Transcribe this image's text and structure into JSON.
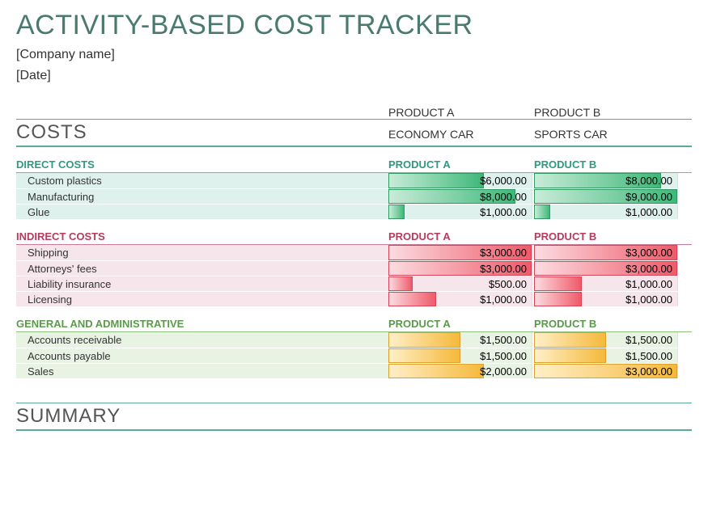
{
  "title": "ACTIVITY-BASED COST TRACKER",
  "company": "[Company name]",
  "date": "[Date]",
  "product_labels": {
    "a": "PRODUCT A",
    "b": "PRODUCT B"
  },
  "costs_heading": "COSTS",
  "product_names": {
    "a": "ECONOMY CAR",
    "b": "SPORTS CAR"
  },
  "summary_heading": "SUMMARY",
  "sections": {
    "direct": {
      "title": "DIRECT COSTS",
      "col_a": "PRODUCT A",
      "col_b": "PRODUCT B",
      "max": 9000,
      "rows": [
        {
          "label": "Custom plastics",
          "a_val": 6000,
          "a_text": "$6,000.00",
          "b_val": 8000,
          "b_text": "$8,000.00"
        },
        {
          "label": "Manufacturing",
          "a_val": 8000,
          "a_text": "$8,000.00",
          "b_val": 9000,
          "b_text": "$9,000.00"
        },
        {
          "label": "Glue",
          "a_val": 1000,
          "a_text": "$1,000.00",
          "b_val": 1000,
          "b_text": "$1,000.00"
        }
      ]
    },
    "indirect": {
      "title": "INDIRECT COSTS",
      "col_a": "PRODUCT A",
      "col_b": "PRODUCT B",
      "max": 3000,
      "rows": [
        {
          "label": "Shipping",
          "a_val": 3000,
          "a_text": "$3,000.00",
          "b_val": 3000,
          "b_text": "$3,000.00"
        },
        {
          "label": "Attorneys' fees",
          "a_val": 3000,
          "a_text": "$3,000.00",
          "b_val": 3000,
          "b_text": "$3,000.00"
        },
        {
          "label": "Liability insurance",
          "a_val": 500,
          "a_text": "$500.00",
          "b_val": 1000,
          "b_text": "$1,000.00"
        },
        {
          "label": "Licensing",
          "a_val": 1000,
          "a_text": "$1,000.00",
          "b_val": 1000,
          "b_text": "$1,000.00"
        }
      ]
    },
    "ga": {
      "title": "GENERAL AND ADMINISTRATIVE",
      "col_a": "PRODUCT A",
      "col_b": "PRODUCT B",
      "max": 3000,
      "rows": [
        {
          "label": "Accounts receivable",
          "a_val": 1500,
          "a_text": "$1,500.00",
          "b_val": 1500,
          "b_text": "$1,500.00"
        },
        {
          "label": "Accounts payable",
          "a_val": 1500,
          "a_text": "$1,500.00",
          "b_val": 1500,
          "b_text": "$1,500.00"
        },
        {
          "label": "Sales",
          "a_val": 2000,
          "a_text": "$2,000.00",
          "b_val": 3000,
          "b_text": "$3,000.00"
        }
      ]
    }
  }
}
